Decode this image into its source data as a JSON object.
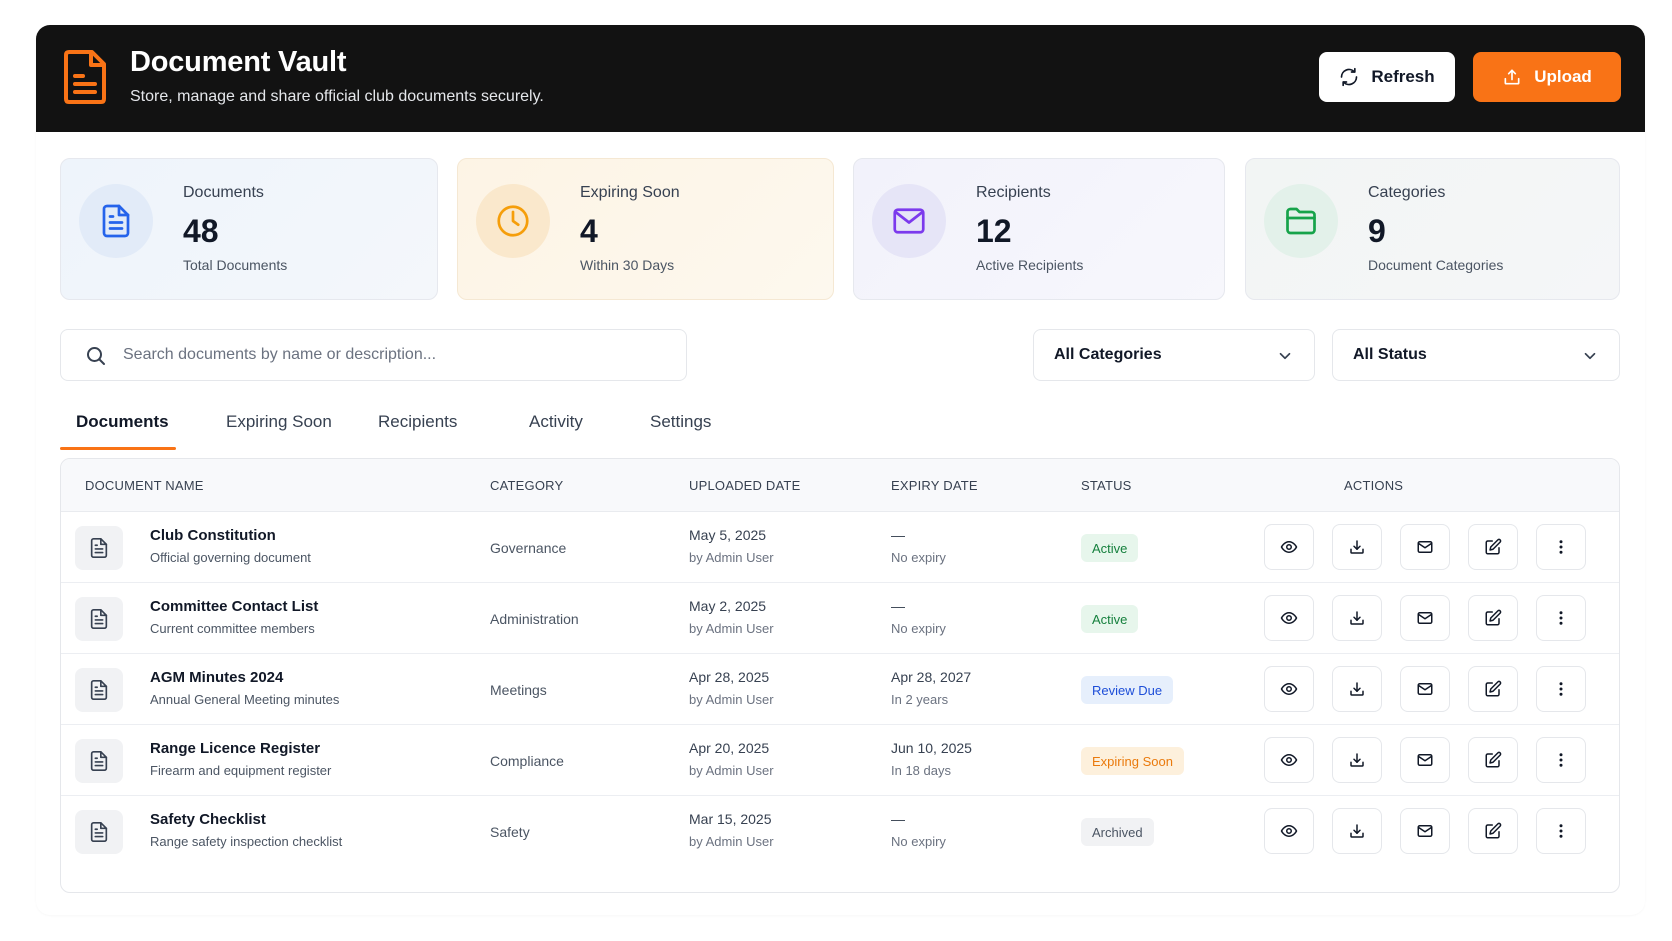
{
  "header": {
    "title": "Document Vault",
    "subtitle": "Store, manage and share official club documents securely.",
    "refresh_label": "Refresh",
    "upload_label": "Upload",
    "logo_icon": "document-icon",
    "accent_color": "#f97316"
  },
  "stats": [
    {
      "label": "Documents",
      "value": "48",
      "desc": "Total Documents",
      "icon": "file-text-icon",
      "color": "#2563eb"
    },
    {
      "label": "Expiring Soon",
      "value": "4",
      "desc": "Within 30 Days",
      "icon": "clock-icon",
      "color": "#f59e0b"
    },
    {
      "label": "Recipients",
      "value": "12",
      "desc": "Active Recipients",
      "icon": "mail-icon",
      "color": "#7c3aed"
    },
    {
      "label": "Categories",
      "value": "9",
      "desc": "Document Categories",
      "icon": "folder-icon",
      "color": "#16a34a"
    }
  ],
  "search": {
    "placeholder": "Search documents by name or description..."
  },
  "filters": {
    "category": "All Categories",
    "status": "All Status"
  },
  "tabs": [
    {
      "label": "Documents",
      "active": true
    },
    {
      "label": "Expiring Soon",
      "active": false
    },
    {
      "label": "Recipients",
      "active": false
    },
    {
      "label": "Activity",
      "active": false
    },
    {
      "label": "Settings",
      "active": false
    }
  ],
  "table": {
    "headers": [
      "DOCUMENT NAME",
      "CATEGORY",
      "UPLOADED DATE",
      "EXPIRY DATE",
      "STATUS",
      "ACTIONS"
    ],
    "rows": [
      {
        "name": "Club Constitution",
        "desc": "Official governing document",
        "category": "Governance",
        "uploaded": "May 5, 2025",
        "uploaded_by": "by Admin User",
        "expiry": "—",
        "expiry_note": "No expiry",
        "status": "Active",
        "status_kind": "active"
      },
      {
        "name": "Committee Contact List",
        "desc": "Current committee members",
        "category": "Administration",
        "uploaded": "May 2, 2025",
        "uploaded_by": "by Admin User",
        "expiry": "—",
        "expiry_note": "No expiry",
        "status": "Active",
        "status_kind": "active"
      },
      {
        "name": "AGM Minutes 2024",
        "desc": "Annual General Meeting minutes",
        "category": "Meetings",
        "uploaded": "Apr 28, 2025",
        "uploaded_by": "by Admin User",
        "expiry": "Apr 28, 2027",
        "expiry_note": "In 2 years",
        "status": "Review Due",
        "status_kind": "review"
      },
      {
        "name": "Range Licence Register",
        "desc": "Firearm and equipment register",
        "category": "Compliance",
        "uploaded": "Apr 20, 2025",
        "uploaded_by": "by Admin User",
        "expiry": "Jun 10, 2025",
        "expiry_note": "In 18 days",
        "status": "Expiring Soon",
        "status_kind": "expiring"
      },
      {
        "name": "Safety Checklist",
        "desc": "Range safety inspection checklist",
        "category": "Safety",
        "uploaded": "Mar 15, 2025",
        "uploaded_by": "by Admin User",
        "expiry": "—",
        "expiry_note": "No expiry",
        "status": "Archived",
        "status_kind": "archived"
      }
    ],
    "action_icons": [
      "eye-icon",
      "download-icon",
      "mail-icon",
      "edit-icon",
      "more-vertical-icon"
    ]
  },
  "status_colors": {
    "active": {
      "bg": "#e7f6ec",
      "fg": "#15803d"
    },
    "review": {
      "bg": "#e6effc",
      "fg": "#1d4ed8"
    },
    "expiring": {
      "bg": "#fdf0dc",
      "fg": "#ea7a0c"
    },
    "archived": {
      "bg": "#f1f2f4",
      "fg": "#4b5563"
    }
  }
}
